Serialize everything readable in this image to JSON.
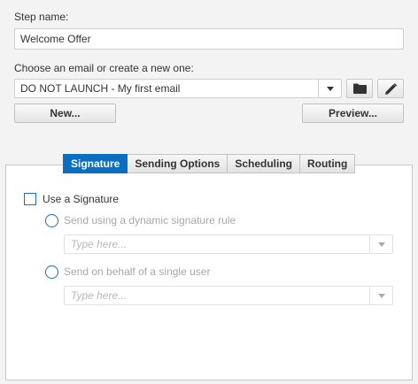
{
  "step": {
    "label": "Step name:",
    "value": "Welcome Offer"
  },
  "email": {
    "label": "Choose an email or create a new one:",
    "selected": "DO NOT LAUNCH - My first email",
    "new_button": "New...",
    "preview_button": "Preview..."
  },
  "tabs": [
    {
      "label": "Signature",
      "active": true
    },
    {
      "label": "Sending Options",
      "active": false
    },
    {
      "label": "Scheduling",
      "active": false
    },
    {
      "label": "Routing",
      "active": false
    }
  ],
  "signature": {
    "use_label": "Use a Signature",
    "option1_label": "Send using a dynamic signature rule",
    "option1_placeholder": "Type here...",
    "option2_label": "Send on behalf of a single user",
    "option2_placeholder": "Type here..."
  },
  "colors": {
    "accent": "#0a6fc2"
  }
}
